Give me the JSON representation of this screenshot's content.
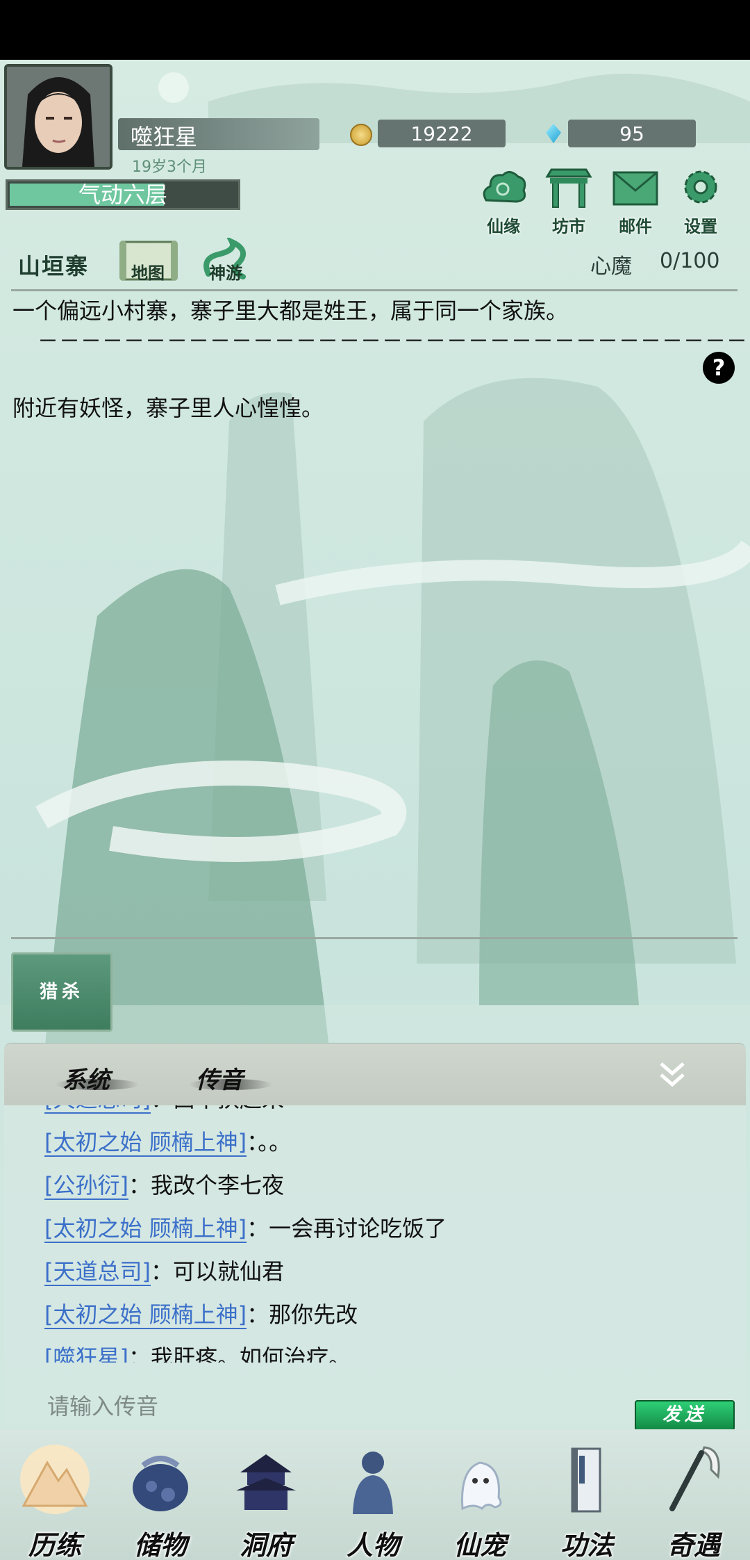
{
  "player": {
    "name": "噬狂星",
    "age": "19岁3个月",
    "realm": "气动六层",
    "realm_progress": 0.68,
    "coins": "19222",
    "gems": "95"
  },
  "top_buttons": [
    {
      "label": "仙缘",
      "icon": "cloud-icon"
    },
    {
      "label": "坊市",
      "icon": "market-icon"
    },
    {
      "label": "邮件",
      "icon": "mail-icon"
    },
    {
      "label": "设置",
      "icon": "gear-icon"
    }
  ],
  "location": {
    "name": "山垣寨",
    "map_label": "地图",
    "travel_label": "神游"
  },
  "xinmo": {
    "label": "心魔",
    "value": "0/100"
  },
  "story": {
    "line1": "一个偏远小村寨，寨子里大都是姓王，属于同一个家族。",
    "separator": "－－－－－－－－－－－－－－－－－－－－－－－－－－－－－－－－－－－－－－－－－－",
    "line2": "附近有妖怪，寨子里人心惶惶。",
    "help": "?"
  },
  "action": {
    "hunt_label": "猎杀"
  },
  "chat": {
    "tabs": [
      "系统",
      "传音"
    ],
    "messages": [
      {
        "name": "[天道总司]",
        "text": "：西不扶起来"
      },
      {
        "name": "[太初之始 顾楠上神]",
        "text": "：。。"
      },
      {
        "name": "[公孙衍]",
        "text": "：我改个李七夜"
      },
      {
        "name": "[太初之始 顾楠上神]",
        "text": "：一会再讨论吃饭了"
      },
      {
        "name": "[天道总司]",
        "text": "：可以就仙君"
      },
      {
        "name": "[太初之始 顾楠上神]",
        "text": "：那你先改"
      },
      {
        "name": "[噬狂星]",
        "text": "：我肝疼。如何治疗。"
      }
    ],
    "input_placeholder": "请输入传音",
    "send_label": "发送"
  },
  "nav": [
    {
      "label": "历练",
      "icon": "mountain-icon"
    },
    {
      "label": "储物",
      "icon": "bag-icon"
    },
    {
      "label": "洞府",
      "icon": "pagoda-icon"
    },
    {
      "label": "人物",
      "icon": "person-icon"
    },
    {
      "label": "仙宠",
      "icon": "ghost-pet-icon"
    },
    {
      "label": "功法",
      "icon": "scroll-book-icon"
    },
    {
      "label": "奇遇",
      "icon": "brush-icon"
    }
  ]
}
